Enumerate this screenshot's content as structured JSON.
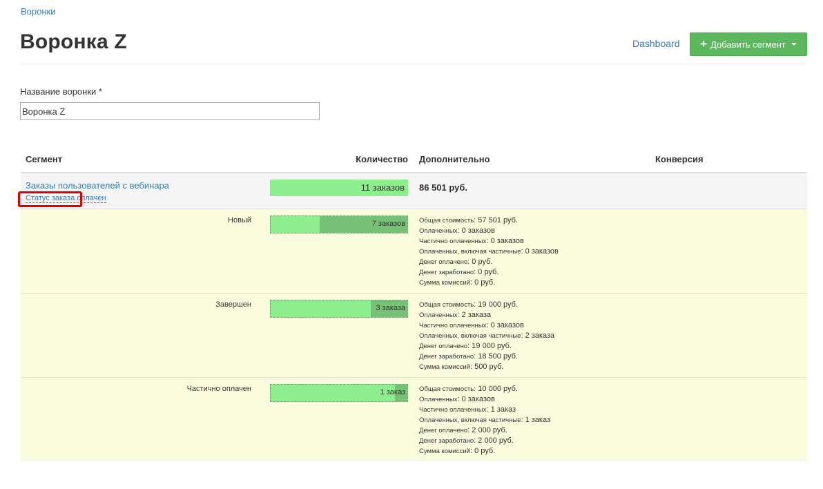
{
  "breadcrumb": "Воронки",
  "page_title": "Воронка Z",
  "header": {
    "dashboard_label": "Dashboard",
    "add_segment_label": "Добавить сегмент"
  },
  "form": {
    "name_label": "Название воронки *",
    "name_value": "Воронка Z"
  },
  "table": {
    "headers": {
      "segment": "Сегмент",
      "count": "Количество",
      "extra": "Дополнительно",
      "conversion": "Конверсия"
    },
    "segment": {
      "name": "Заказы пользователей с вебинара",
      "filter": "Статус заказа оплачен",
      "count_label": "11 заказов",
      "sum": "86 501 руб."
    },
    "substatuses": [
      {
        "status": "Новый",
        "count_label": "7 заказов",
        "share": 0.64,
        "details": [
          {
            "key": "Общая стоимость",
            "value": "57 501 руб."
          },
          {
            "key": "Оплаченных",
            "value": "0 заказов"
          },
          {
            "key": "Частично оплаченных",
            "value": "0 заказов"
          },
          {
            "key": "Оплаченных, включая частичные",
            "value": "0 заказов"
          },
          {
            "key": "Денег оплачено",
            "value": "0 руб."
          },
          {
            "key": "Денег заработано",
            "value": "0 руб."
          },
          {
            "key": "Сумма комиссий",
            "value": "0 руб."
          }
        ]
      },
      {
        "status": "Завершен",
        "count_label": "3 заказа",
        "share": 0.27,
        "details": [
          {
            "key": "Общая стоимость",
            "value": "19 000 руб."
          },
          {
            "key": "Оплаченных",
            "value": "2 заказа"
          },
          {
            "key": "Частично оплаченных",
            "value": "0 заказов"
          },
          {
            "key": "Оплаченных, включая частичные",
            "value": "2 заказа"
          },
          {
            "key": "Денег оплачено",
            "value": "19 000 руб."
          },
          {
            "key": "Денег заработано",
            "value": "18 500 руб."
          },
          {
            "key": "Сумма комиссий",
            "value": "500 руб."
          }
        ]
      },
      {
        "status": "Частично оплачен",
        "count_label": "1 заказ",
        "share": 0.09,
        "details": [
          {
            "key": "Общая стоимость",
            "value": "10 000 руб."
          },
          {
            "key": "Оплаченных",
            "value": "0 заказов"
          },
          {
            "key": "Частично оплаченных",
            "value": "1 заказ"
          },
          {
            "key": "Оплаченных, включая частичные",
            "value": "1 заказ"
          },
          {
            "key": "Денег оплачено",
            "value": "2 000 руб."
          },
          {
            "key": "Денег заработано",
            "value": "2 000 руб."
          },
          {
            "key": "Сумма комиссий",
            "value": "0 руб."
          }
        ]
      }
    ]
  }
}
